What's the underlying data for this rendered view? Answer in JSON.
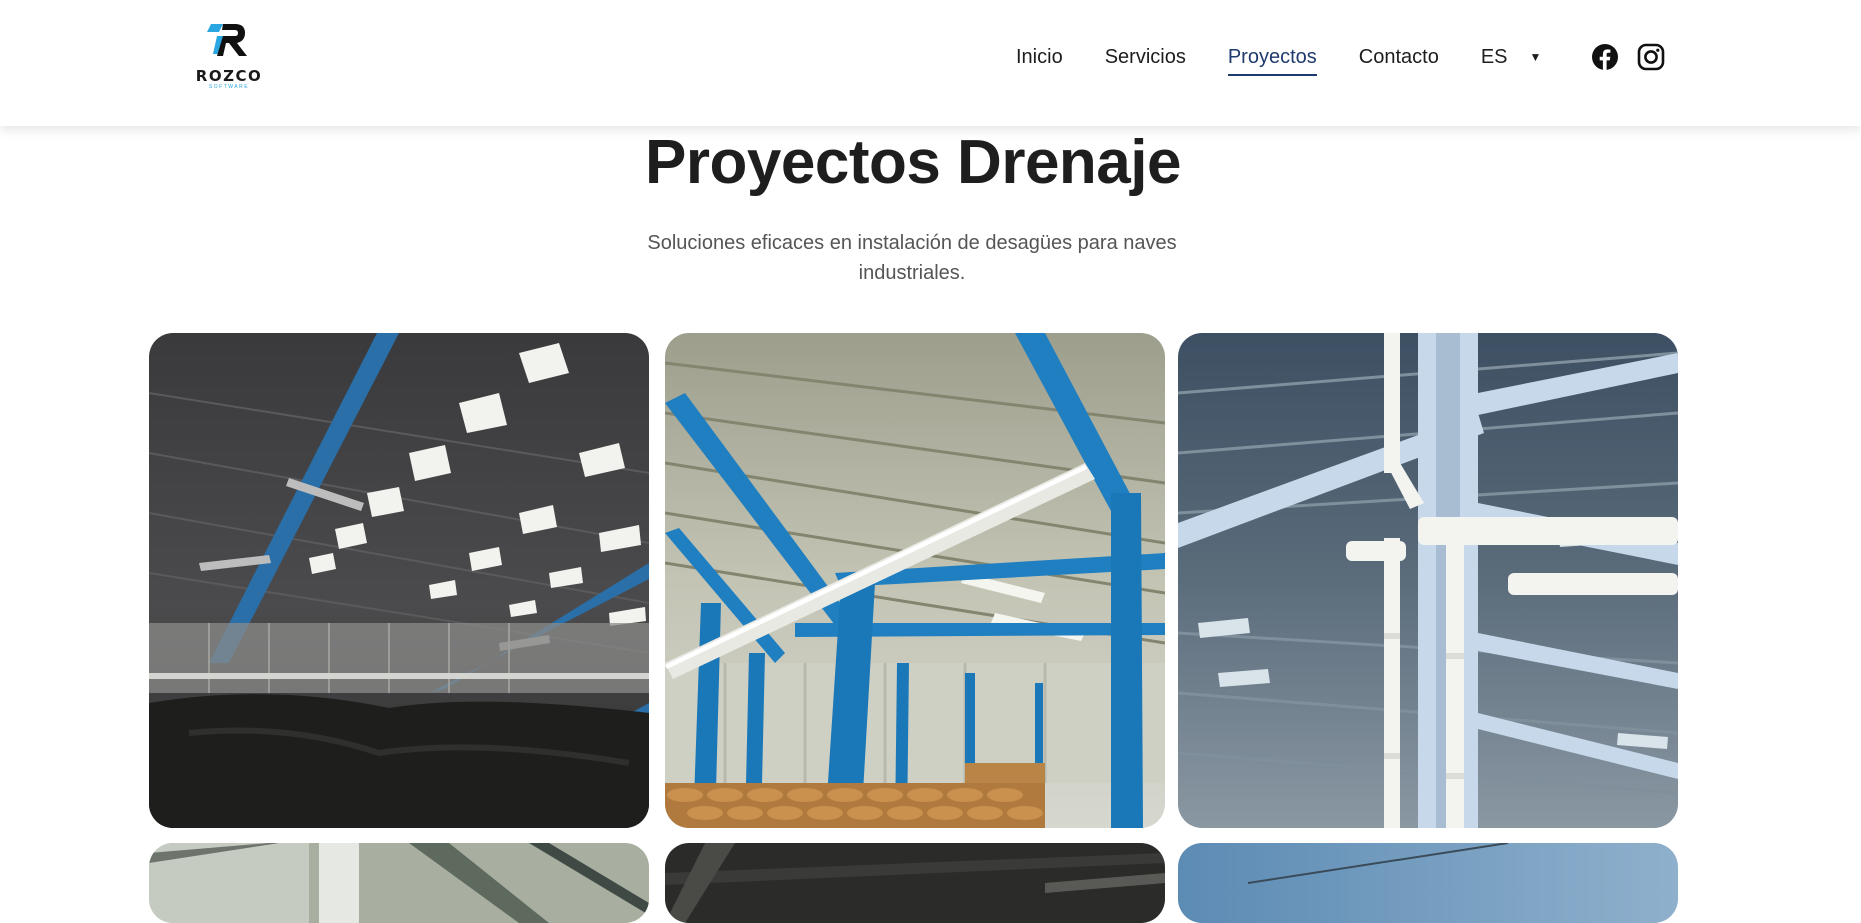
{
  "brand": {
    "name": "ROZCO",
    "tagline": "SOFTWARE",
    "accent": "#2aa6e0"
  },
  "nav": {
    "items": [
      {
        "label": "Inicio"
      },
      {
        "label": "Servicios"
      },
      {
        "label": "Proyectos",
        "active": true
      },
      {
        "label": "Contacto"
      }
    ],
    "active_color": "#1f3a6e",
    "language": "ES",
    "social": [
      "facebook-icon",
      "instagram-icon"
    ]
  },
  "hero": {
    "title": "Proyectos Drenaje",
    "subtitle": "Soluciones eficaces en instalación de desagües para naves industriales."
  },
  "gallery": {
    "items": [
      {
        "subject": "Dark warehouse roof with skylights and blue steel beams"
      },
      {
        "subject": "Warehouse interior with blue columns, white drain pipe and stacked sacks"
      },
      {
        "subject": "White PVC downpipes on light blue steel structure"
      },
      {
        "subject": "Roof structure (partially visible)"
      },
      {
        "subject": "Dark warehouse roof (partially visible)"
      },
      {
        "subject": "Blue sky with cable (partially visible)"
      }
    ]
  }
}
